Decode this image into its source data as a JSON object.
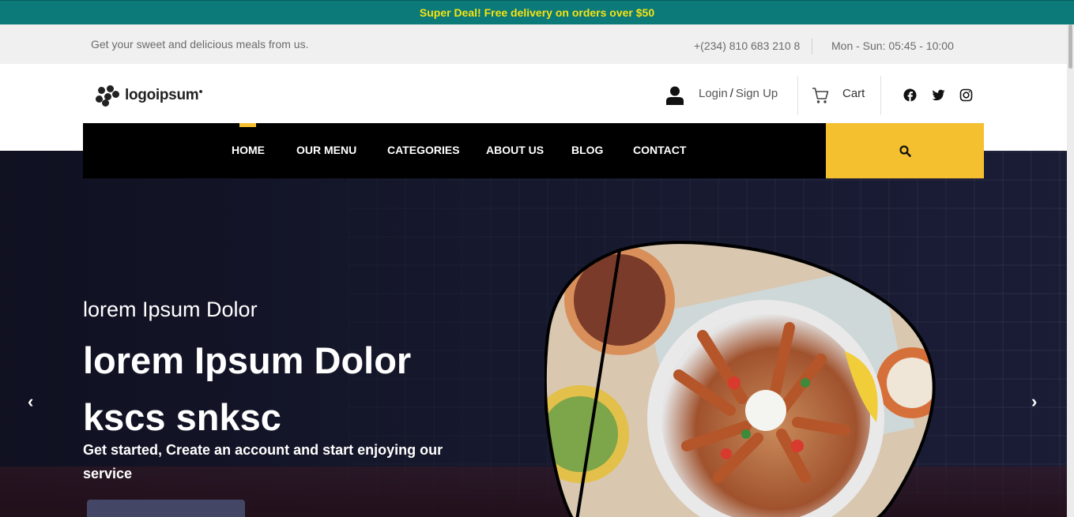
{
  "promo": {
    "text": "Super Deal! Free delivery on orders over $50"
  },
  "info_bar": {
    "tagline": "Get your sweet and delicious meals from us.",
    "phone": "+(234) 810 683 210 8",
    "hours": "Mon - Sun: 05:45 - 10:00"
  },
  "header": {
    "logo_text": "logoipsum",
    "login_label": "Login",
    "separator": "/",
    "signup_label": "Sign Up",
    "cart_label": "Cart",
    "social": [
      "facebook-icon",
      "twitter-icon",
      "instagram-icon"
    ]
  },
  "nav": {
    "items": [
      "HOME",
      "OUR MENU",
      "CATEGORIES",
      "ABOUT US",
      "BLOG",
      "CONTACT"
    ],
    "active": "HOME",
    "accent": "#f5c030"
  },
  "hero": {
    "subtitle": "lorem Ipsum Dolor",
    "title": "lorem Ipsum Dolor kscs snksc",
    "description": "Get started, Create an account and start enjoying our service",
    "prev": "‹",
    "next": "›"
  },
  "colors": {
    "promo_bg": "#0b7a78",
    "promo_text": "#f7e313",
    "nav_bg": "#000000",
    "search_bg": "#f5c030"
  }
}
